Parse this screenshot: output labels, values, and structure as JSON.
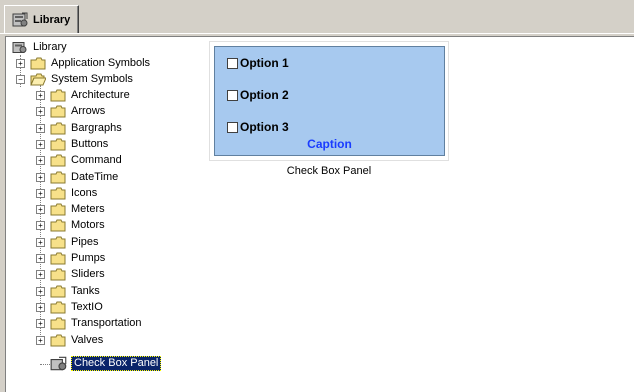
{
  "tab": {
    "label": "Library",
    "icon": "library-icon"
  },
  "tree": {
    "root": "Library",
    "application_symbols": "Application Symbols",
    "system_symbols": "System Symbols",
    "children": [
      "Architecture",
      "Arrows",
      "Bargraphs",
      "Buttons",
      "Command",
      "DateTime",
      "Icons",
      "Meters",
      "Motors",
      "Pipes",
      "Pumps",
      "Sliders",
      "Tanks",
      "TextIO",
      "Transportation",
      "Valves"
    ],
    "selected_item": "Check Box Panel"
  },
  "preview": {
    "options": [
      "Option 1",
      "Option 2",
      "Option 3"
    ],
    "caption": "Caption",
    "label": "Check Box Panel"
  },
  "colors": {
    "panel_bg": "#a7c9ef",
    "caption": "#1a3cff",
    "selection": "#0a246a"
  }
}
